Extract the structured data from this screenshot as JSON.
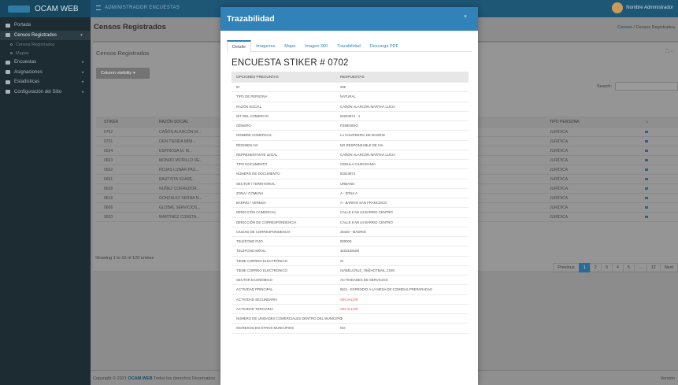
{
  "app": {
    "brand": "OCAM WEB",
    "top_title": "ADMINISTRADOR ENCUESTAS",
    "user_name": "Nombre Administrador"
  },
  "sidebar": {
    "items": [
      {
        "label": "Portada",
        "icon": "dashboard-icon"
      },
      {
        "label": "Censos Registrados",
        "icon": "folder-icon",
        "active": true
      },
      {
        "label": "Censos Registrados",
        "sub": true
      },
      {
        "label": "Mapas",
        "sub": true
      },
      {
        "label": "Encuestas",
        "icon": "survey-icon"
      },
      {
        "label": "Asignaciones",
        "icon": "list-icon"
      },
      {
        "label": "Estadisticas",
        "icon": "chart-icon"
      },
      {
        "label": "Configuración del Sitio",
        "icon": "gears-icon"
      }
    ]
  },
  "content": {
    "title": "Censos Registrados",
    "breadcrumb_home": "Censos",
    "breadcrumb_current": "Censos Registrados",
    "card_title": "Censos Registrados",
    "column_visibility": "Column visibility ▾",
    "search_label": "Search:",
    "table_headers": [
      "STIKER",
      "RAZÓN SOCIAL",
      "TIPO PERSONA"
    ],
    "rows": [
      {
        "stiker": "0702",
        "razon": "CAÑÓN ALARCÓN M...",
        "tipo": "JURÍDICA"
      },
      {
        "stiker": "0701",
        "razon": "ORN TIENDA MINI...",
        "tipo": "JURÍDICA"
      },
      {
        "stiker": "0694",
        "razon": "ESPINOSA M. M...",
        "tipo": "JURÍDICA"
      },
      {
        "stiker": "0693",
        "razon": "MONRO MORILLO DE...",
        "tipo": "JURÍDICA"
      },
      {
        "stiker": "0692",
        "razon": "ROJAS LUNAR PAU...",
        "tipo": "JURÍDICA"
      },
      {
        "stiker": "0691",
        "razon": "BAUTISTA SUARE...",
        "tipo": "JURÍDICA"
      },
      {
        "stiker": "0628",
        "razon": "NUÑEZ CORREDOR...",
        "tipo": "JURÍDICA"
      },
      {
        "stiker": "0616",
        "razon": "GONZALEZ SERNA N...",
        "tipo": "JURÍDICA"
      },
      {
        "stiker": "0606",
        "razon": "GLOBAL SERVICIOS...",
        "tipo": "JURÍDICA"
      },
      {
        "stiker": "0600",
        "razon": "MARTINEZ CONSTA...",
        "tipo": "JURÍDICA"
      }
    ],
    "showing": "Showing 1 to 10 of 120 entries",
    "pager": [
      "Previous",
      "1",
      "2",
      "3",
      "4",
      "5",
      "...",
      "12",
      "Next"
    ],
    "footer_left_prefix": "Copyright © 2021",
    "footer_brand": "OCAM WEB",
    "footer_left_suffix": "Todos los derechos Reservados",
    "footer_right": "Version"
  },
  "modal": {
    "title": "Trazabilidad",
    "close": "×",
    "tabs": [
      "Detalle",
      "Imagenes",
      "Mapa",
      "Imagen 360",
      "Trazabilidad",
      "Descarga PDF"
    ],
    "survey_title": "ENCUESTA STIKER # 0702",
    "head_key": "OPCIONES PREGUNTAS",
    "head_value": "RESPUESTAS",
    "rows": [
      {
        "k": "ID",
        "v": "265"
      },
      {
        "k": "TIPO DE PERSONA",
        "v": "NATURAL"
      },
      {
        "k": "RAZÓN SOCIAL",
        "v": "CAÑÓN ALARCÓN MARTHA LUCIA"
      },
      {
        "k": "NIT DEL COMERCIO",
        "v": "52023874 - 1"
      },
      {
        "k": "GÉNERO",
        "v": "FEMENINO"
      },
      {
        "k": "NOMBRE COMERCIAL",
        "v": "LA CHURRERIA DE MADRID"
      },
      {
        "k": "RÉGIMEN IVA",
        "v": "NO RESPONSABLE DE IVA"
      },
      {
        "k": "REPRESENTANTE LEGAL",
        "v": "CAÑÓN ALARCÓN MARTHA LUCIA"
      },
      {
        "k": "TIPO DOCUMENTO",
        "v": "CEDULA CIUDADANIA"
      },
      {
        "k": "NÚMERO DE DOCUMENTO",
        "v": "52023874"
      },
      {
        "k": "SECTOR / TERRITORIAL",
        "v": "URBANO"
      },
      {
        "k": "ZONA / COMUNA",
        "v": "A - ZONA A"
      },
      {
        "k": "BARRIO / VEREDA",
        "v": "A - BARRIO SAN FRANCISCO"
      },
      {
        "k": "DIRECCIÓN COMERCIAL",
        "v": "CALLE 6 N6 44 BARRIO CENTRO"
      },
      {
        "k": "DIRECCIÓN DE CORRESPONDENCIA",
        "v": "CALLE 6 N6 44 BARRIO CENTRO"
      },
      {
        "k": "CIUDAD DE CORRESPONDENCIA",
        "v": "25430 - MADRID"
      },
      {
        "k": "TELÉFONO FIJO",
        "v": "000000"
      },
      {
        "k": "TELÉFONO MÓVIL",
        "v": "3203168168"
      },
      {
        "k": "TIENE CORREO ELECTRÓNICO",
        "v": "SI"
      },
      {
        "k": "TIENE CORREO ELECTRONICO",
        "v": "ISABELCRUZ_79@HOTMAIL.COM"
      },
      {
        "k": "SECTOR ECONÓMICO",
        "v": "ACTIVIDADES DE SERVICIOS"
      },
      {
        "k": "ACTIVIDAD PRINCIPAL",
        "v": "5611 - EXPENDIO A LA MESA DE COMIDAS PREPARADAS"
      },
      {
        "k": "ACTIVIDAD SECUNDARIA",
        "v": "SIN VALOR",
        "null": true
      },
      {
        "k": "ACTIVIDAD TERCIARIA",
        "v": "SIN VALOR",
        "null": true
      },
      {
        "k": "NÚMERO DE UNIDADES COMERCIALES DENTRO DEL MUNICIPIO",
        "v": "1"
      },
      {
        "k": "INGRESOS EN OTROS MUNICIPIOS",
        "v": "NO"
      }
    ]
  }
}
